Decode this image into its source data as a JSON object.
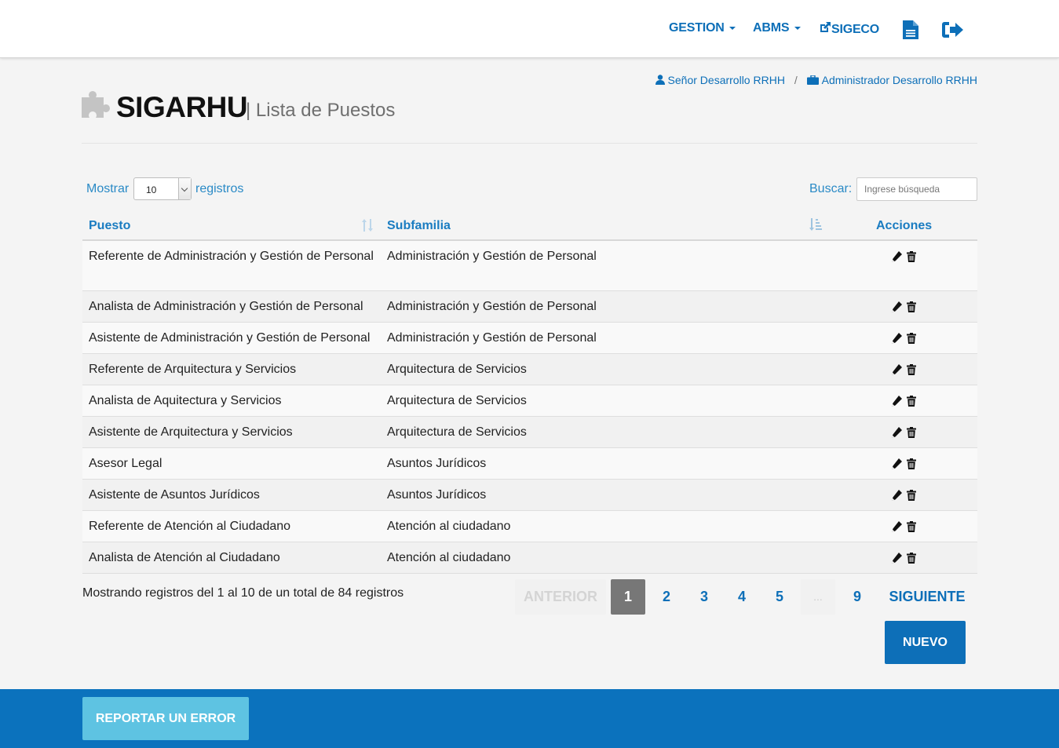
{
  "nav": {
    "gestion": "GESTION",
    "abms": "ABMS",
    "sigeco": "SIGECO",
    "document_icon": "document-icon",
    "logout_icon": "sign-out-icon"
  },
  "breadcrumb": {
    "user": "Señor Desarrollo RRHH",
    "separator": "/",
    "role": "Administrador Desarrollo RRHH"
  },
  "header": {
    "title": "SIGARHU",
    "subtitle": "| Lista de Puestos"
  },
  "controls": {
    "show_label": "Mostrar",
    "page_size": "10",
    "records_label": "registros",
    "search_label": "Buscar:",
    "search_placeholder": "Ingrese búsqueda",
    "search_value": ""
  },
  "table": {
    "columns": [
      "Puesto",
      "Subfamilia",
      "Acciones"
    ],
    "rows": [
      {
        "puesto": "Referente de Administración y Gestión de Personal",
        "subfamilia": "Administración y Gestión de Personal"
      },
      {
        "puesto": "Analista de Administración y Gestión de Personal",
        "subfamilia": "Administración y Gestión de Personal"
      },
      {
        "puesto": "Asistente de Administración y Gestión de Personal",
        "subfamilia": "Administración y Gestión de Personal"
      },
      {
        "puesto": "Referente de Arquitectura y Servicios",
        "subfamilia": "Arquitectura de Servicios"
      },
      {
        "puesto": "Analista de Aquitectura y Servicios",
        "subfamilia": "Arquitectura de Servicios"
      },
      {
        "puesto": "Asistente de Arquitectura y Servicios",
        "subfamilia": "Arquitectura de Servicios"
      },
      {
        "puesto": "Asesor Legal",
        "subfamilia": "Asuntos Jurídicos"
      },
      {
        "puesto": "Asistente de Asuntos Jurídicos",
        "subfamilia": "Asuntos Jurídicos"
      },
      {
        "puesto": "Referente de Atención al Ciudadano",
        "subfamilia": "Atención al ciudadano"
      },
      {
        "puesto": "Analista de Atención al Ciudadano",
        "subfamilia": "Atención al ciudadano"
      }
    ]
  },
  "info": "Mostrando registros del 1 al 10 de un total de 84 registros",
  "pagination": {
    "previous": "ANTERIOR",
    "pages": [
      "1",
      "2",
      "3",
      "4",
      "5"
    ],
    "ellipsis": "...",
    "last": "9",
    "next": "SIGUIENTE",
    "current": "1"
  },
  "buttons": {
    "new": "NUEVO",
    "report_error": "REPORTAR UN ERROR"
  },
  "colors": {
    "primary": "#0d6fb8",
    "link": "#2a8ac6",
    "footer": "#0b72bd",
    "report_button": "#5ec3e2",
    "active_page": "#777777"
  }
}
